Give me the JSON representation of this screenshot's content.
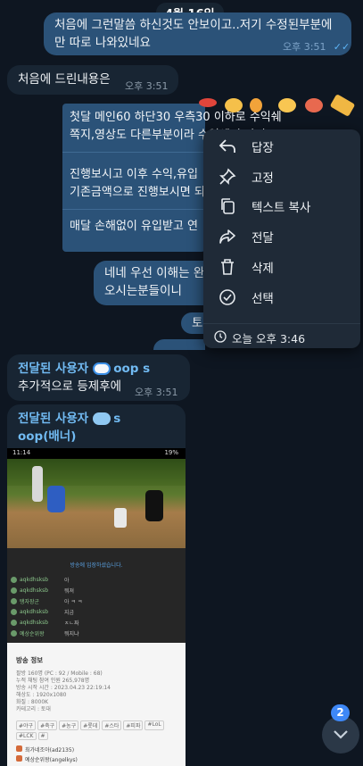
{
  "date_separator": "4월 16일",
  "messages": [
    {
      "text": "처음에 그런말씀 하신것도 안보이고..저기 수정된부분에만 따로 나와있네요",
      "time": "오후 3:51",
      "read": "✓✓"
    },
    {
      "text": "처음에 드린내용은",
      "time": "오후 3:51"
    },
    {
      "line1": "첫달 메인60 하단30 우측30 이하로 수익쉐",
      "line2": "쪽지,영상도 다른부분이라 수익쉐어 안되",
      "line3": "진행보시고 이후 수익,유입",
      "line4": "기존금액으로 진행보시면 되",
      "line5": "매달 손해없이 유입받고 연"
    },
    {
      "line1": "네네 우선 이해는 완",
      "line2": "오시는분들이니"
    },
    {
      "text": "토"
    }
  ],
  "forwarded_1": {
    "label": "전달된 사용자",
    "name": "oop s",
    "text": "추가적으로 등제후에",
    "time": "오후 3:51"
  },
  "forwarded_2": {
    "label": "전달된 사용자",
    "name": "s",
    "name2": "oop(배너)"
  },
  "context_menu": {
    "items": [
      {
        "label": "답장",
        "icon": "reply-icon"
      },
      {
        "label": "고정",
        "icon": "pin-icon"
      },
      {
        "label": "텍스트 복사",
        "icon": "copy-icon"
      },
      {
        "label": "전달",
        "icon": "forward-icon"
      },
      {
        "label": "삭제",
        "icon": "trash-icon"
      },
      {
        "label": "선택",
        "icon": "check-circle-icon"
      }
    ],
    "footer": "오늘 오후 3:46"
  },
  "screenshot": {
    "status_time": "11:14",
    "battery": "19%",
    "notice": "방송에 입장하셨습니다.",
    "chat_rows": [
      {
        "user": "aqkdhsksb",
        "msg": "아"
      },
      {
        "user": "aqkdhsksb",
        "msg": "뭐져"
      },
      {
        "user": "탱자장군",
        "msg": "아 ㅋ ㅋ"
      },
      {
        "user": "aqkdhsksb",
        "msg": "지금"
      },
      {
        "user": "aqkdhsksb",
        "msg": "ㅈㄴ짜"
      },
      {
        "user": "예상순위왕",
        "msg": "뭐지냐"
      }
    ],
    "info_title": "방송 정보",
    "info_lines": [
      "팔방 160명 (PC : 92 / Mobile : 68)",
      "누적 채팅 참여 인원 265,978명",
      "방송 시작 시간 : 2023.04.23 22:19:14",
      "해상도 : 1920x1080",
      "화질 : 8000K",
      "카테고리 : 토대"
    ],
    "tags": [
      "#야구",
      "#축구",
      "#농구",
      "#롯데",
      "#스타",
      "#피파",
      "#LoL",
      "#LCK",
      "#"
    ],
    "viewers": [
      "최가네조아(ad2135)",
      "예상순위왕(angelkys)"
    ]
  },
  "unread_badge": "2",
  "colors": {
    "background": "#0e1621",
    "incoming": "#182533",
    "outgoing": "#2b5278",
    "accent": "#71baf2",
    "badge": "#3e88f7"
  }
}
